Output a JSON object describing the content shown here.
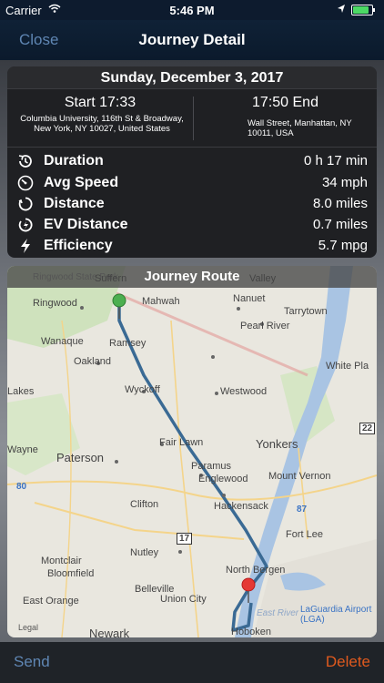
{
  "status_bar": {
    "carrier": "Carrier",
    "time": "5:46 PM"
  },
  "nav": {
    "close_label": "Close",
    "title": "Journey Detail"
  },
  "journey": {
    "date": "Sunday, December 3, 2017",
    "start": {
      "label": "Start 17:33",
      "address": "Columbia University, 116th St & Broadway, New York, NY 10027, United States"
    },
    "end": {
      "label": "17:50 End",
      "address": "Wall Street, Manhattan, NY 10011, USA"
    },
    "stats": [
      {
        "label": "Duration",
        "value": "0 h 17 min",
        "icon": "timer-icon"
      },
      {
        "label": "Avg Speed",
        "value": "34 mph",
        "icon": "speedometer-icon"
      },
      {
        "label": "Distance",
        "value": "8.0 miles",
        "icon": "distance-icon"
      },
      {
        "label": "EV Distance",
        "value": "0.7 miles",
        "icon": "ev-distance-icon"
      },
      {
        "label": "Efficiency",
        "value": "5.7 mpg",
        "icon": "bolt-icon"
      }
    ]
  },
  "map": {
    "title": "Journey Route",
    "legal": "Legal",
    "labels": [
      "Ringwood State Park",
      "Suffern",
      "Valley",
      "Ringwood",
      "Mahwah",
      "Nanuet",
      "Tarrytown",
      "Pearl River",
      "Wanaque",
      "Ramsey",
      "Oakland",
      "White Pla",
      "Lakes",
      "Wyckoff",
      "Westwood",
      "22",
      "Fair Lawn",
      "Wayne",
      "Paterson",
      "Yonkers",
      "80",
      "Paramus",
      "Englewood",
      "Mount Vernon",
      "Clifton",
      "Hackensack",
      "87",
      "Fort Lee",
      "17",
      "Nutley",
      "Montclair",
      "Bloomfield",
      "North Bergen",
      "Belleville",
      "East Orange",
      "Union City",
      "East River",
      "LaGuardia Airport (LGA)",
      "Hoboken",
      "Newark"
    ]
  },
  "bottom": {
    "send_label": "Send",
    "delete_label": "Delete"
  }
}
